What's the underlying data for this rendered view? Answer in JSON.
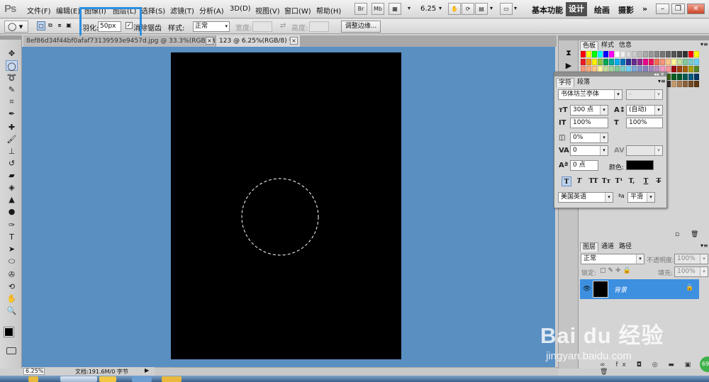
{
  "app": {
    "logo": "Ps"
  },
  "menu": [
    "文件(F)",
    "编辑(E)",
    "图像(I)",
    "图层(L)",
    "选择(S)",
    "滤镜(T)",
    "分析(A)",
    "3D(D)",
    "视图(V)",
    "窗口(W)",
    "帮助(H)"
  ],
  "menubar": {
    "br_label": "Br",
    "mb_label": "Mb",
    "zoom_value": "6.25",
    "workspaces": [
      "基本功能",
      "设计",
      "绘画",
      "摄影"
    ],
    "more": "»"
  },
  "options": {
    "feather_label": "羽化:",
    "feather_value": "50",
    "feather_unit": "px",
    "antialias_label": "消除锯齿",
    "style_label": "样式:",
    "style_value": "正常",
    "width_label": "宽度:",
    "height_label": "高度:",
    "refine_edge_button": "调整边缘..."
  },
  "doc_tabs": [
    {
      "title": "8ef86d34f44bf0afaf73139593e9457d.jpg @ 33.3%(RGB/8#) *",
      "close": "×"
    },
    {
      "title": "123 @ 6.25%(RGB/8) *",
      "close": "×"
    }
  ],
  "swatch_panel": {
    "tabs": [
      "色板",
      "样式",
      "信息"
    ]
  },
  "character_panel": {
    "tabs": [
      "字符",
      "段落"
    ],
    "font_family": "书体坊兰亭体",
    "font_style": "-",
    "size": "300 点",
    "leading": "(自动)",
    "vscale": "100%",
    "hscale": "100%",
    "tracking_ratio": "0%",
    "kerning": "0",
    "tracking": "",
    "baseline": "0 点",
    "color_label": "颜色:",
    "language": "美国英语",
    "aa_label": "a",
    "aa_mode": "平滑",
    "type_buttons": [
      "T",
      "T",
      "TT",
      "Tт",
      "T¹",
      "T,",
      "T",
      "T"
    ]
  },
  "layers_panel": {
    "tabs": [
      "图层",
      "通道",
      "路径"
    ],
    "blend_mode": "正常",
    "opacity_label": "不透明度:",
    "opacity_value": "100%",
    "lock_label": "锁定:",
    "fill_label": "填充:",
    "fill_value": "100%",
    "layer_name": "背景",
    "bottom_icons": "∞ fx ◘ ◎ ▬ ▣ 🗑"
  },
  "status": {
    "zoom": "6.25%",
    "doc_info": "文档:191.6M/0 字节"
  },
  "watermark": {
    "brand": "Bai du 经验",
    "url": "jingyan.baidu.com",
    "badge": "69"
  },
  "colors": {
    "workspace": "#5a8fc2",
    "selected_layer": "#3d8fe0",
    "highlight": "#2b8fe0"
  }
}
